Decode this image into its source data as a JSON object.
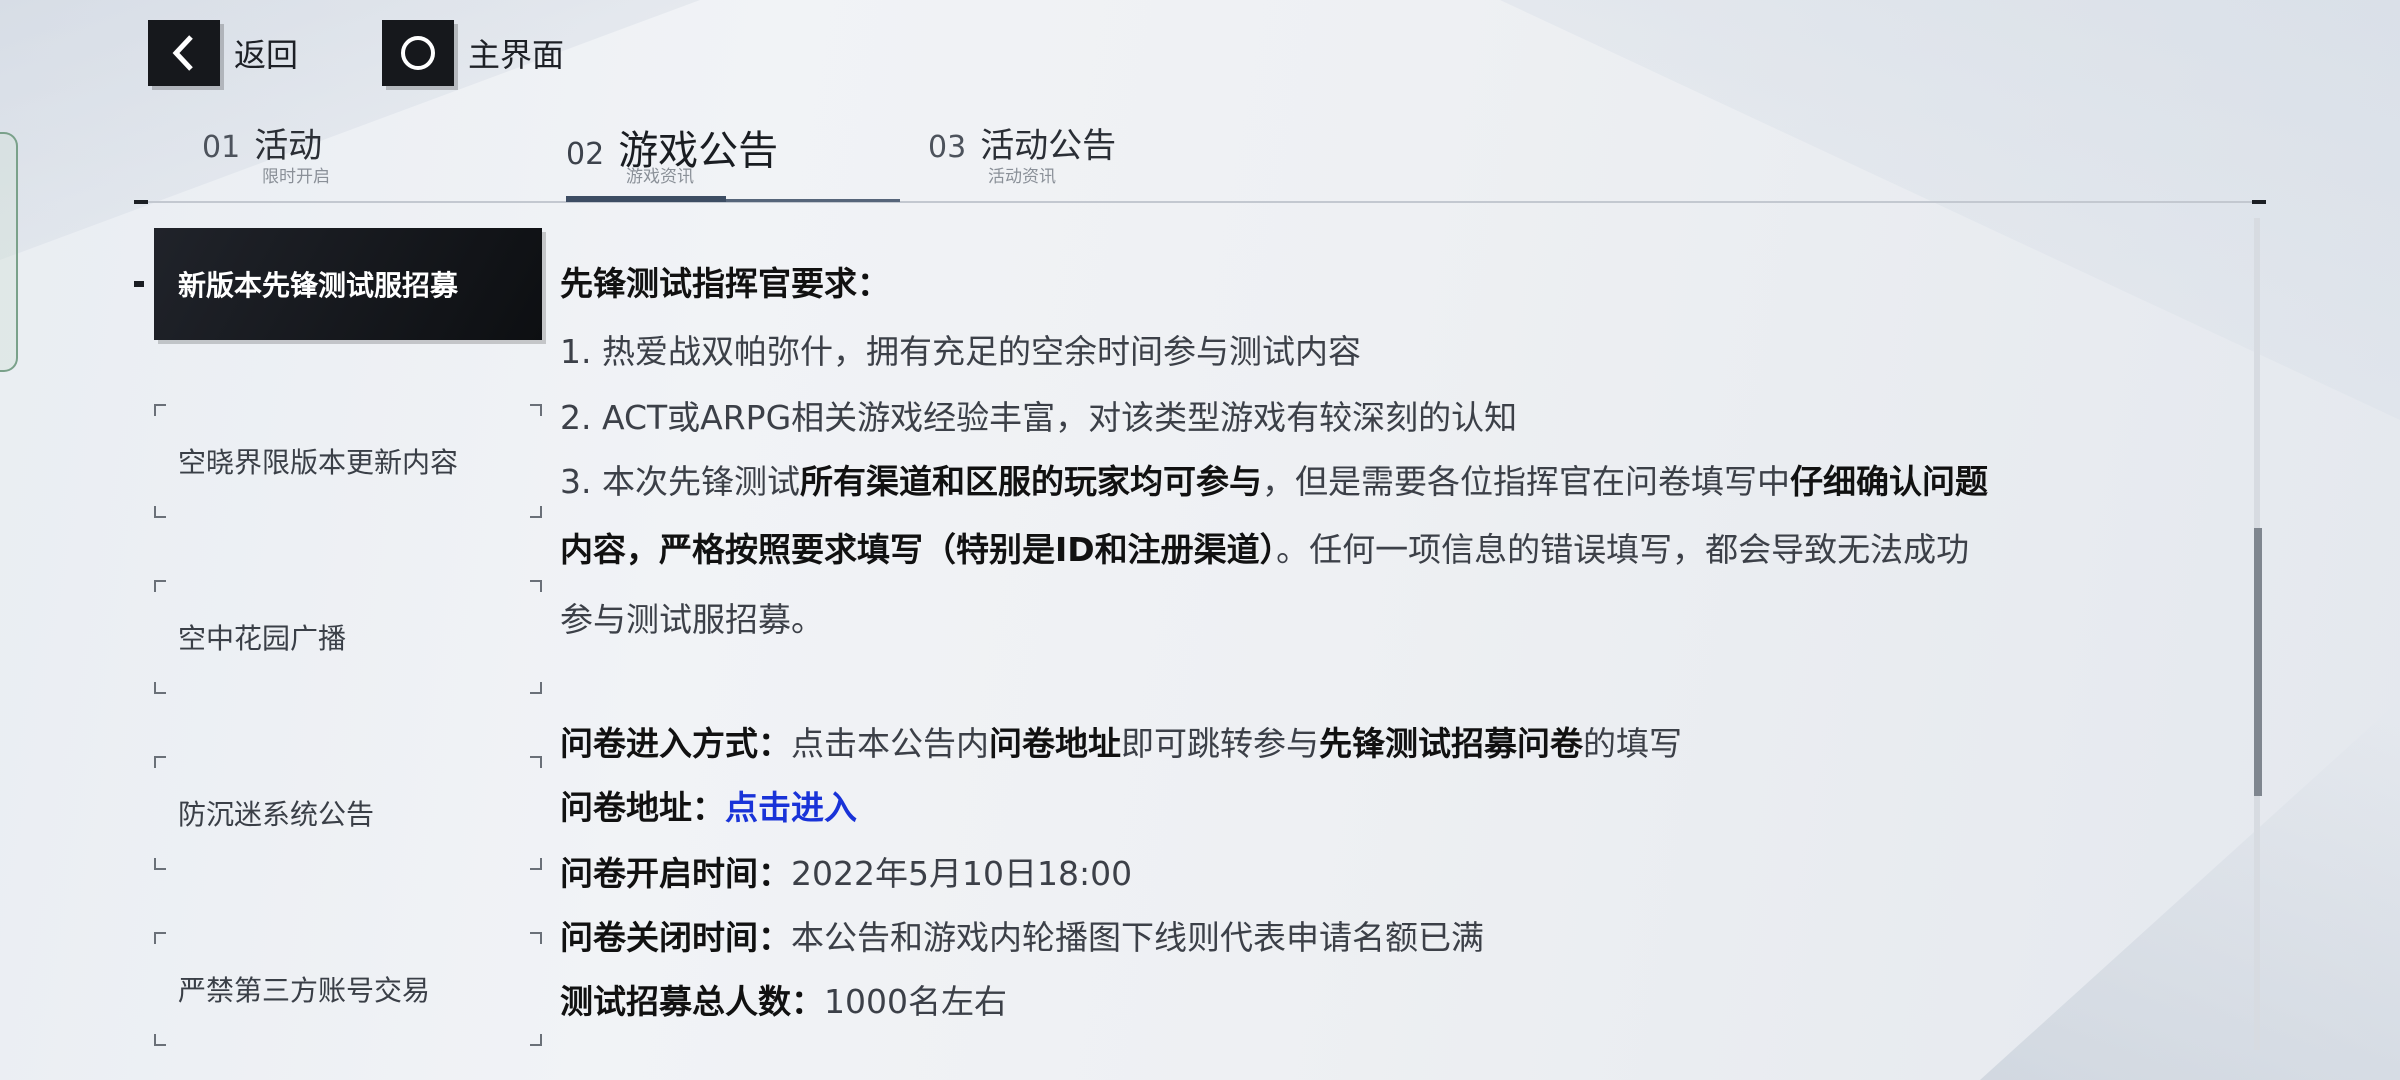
{
  "top_bar": {
    "back_label": "返回",
    "home_label": "主界面"
  },
  "tabs": [
    {
      "num": "01",
      "title": "活动",
      "sub": "限时开启"
    },
    {
      "num": "02",
      "title": "游戏公告",
      "sub": "游戏资讯"
    },
    {
      "num": "03",
      "title": "活动公告",
      "sub": "活动资讯"
    }
  ],
  "active_tab": 1,
  "sidebar": {
    "items": [
      {
        "label": "新版本先锋测试服招募",
        "active": true
      },
      {
        "label": "空晓界限版本更新内容",
        "active": false
      },
      {
        "label": "空中花园广播",
        "active": false
      },
      {
        "label": "防沉迷系统公告",
        "active": false
      },
      {
        "label": "严禁第三方账号交易",
        "active": false
      }
    ]
  },
  "content": {
    "heading": "先锋测试指挥官要求：",
    "req1": "1. 热爱战双帕弥什，拥有充足的空余时间参与测试内容",
    "req2": "2. ACT或ARPG相关游戏经验丰富，对该类型游戏有较深刻的认知",
    "req3_a": "3. 本次先锋测试",
    "req3_b": "所有渠道和区服的玩家均可参与",
    "req3_c": "，但是需要各位指挥官在问卷填写中",
    "req3_d": "仔细确认问题",
    "req3_e": "内容，严格按照要求填写（特别是ID和注册渠道）",
    "req3_f": "。任何一项信息的错误填写，都会导致无法成功",
    "req3_g": "参与测试服招募。",
    "entry_label": "问卷进入方式：",
    "entry_a": "点击本公告内",
    "entry_b": "问卷地址",
    "entry_c": "即可跳转参与",
    "entry_d": "先锋测试招募问卷",
    "entry_e": "的填写",
    "addr_label": "问卷地址：",
    "addr_link": "点击进入",
    "open_label": "问卷开启时间：",
    "open_value": "2022年5月10日18:00",
    "close_label": "问卷关闭时间：",
    "close_value": "本公告和游戏内轮播图下线则代表申请名额已满",
    "total_label": "测试招募总人数：",
    "total_value": "1000名左右"
  }
}
